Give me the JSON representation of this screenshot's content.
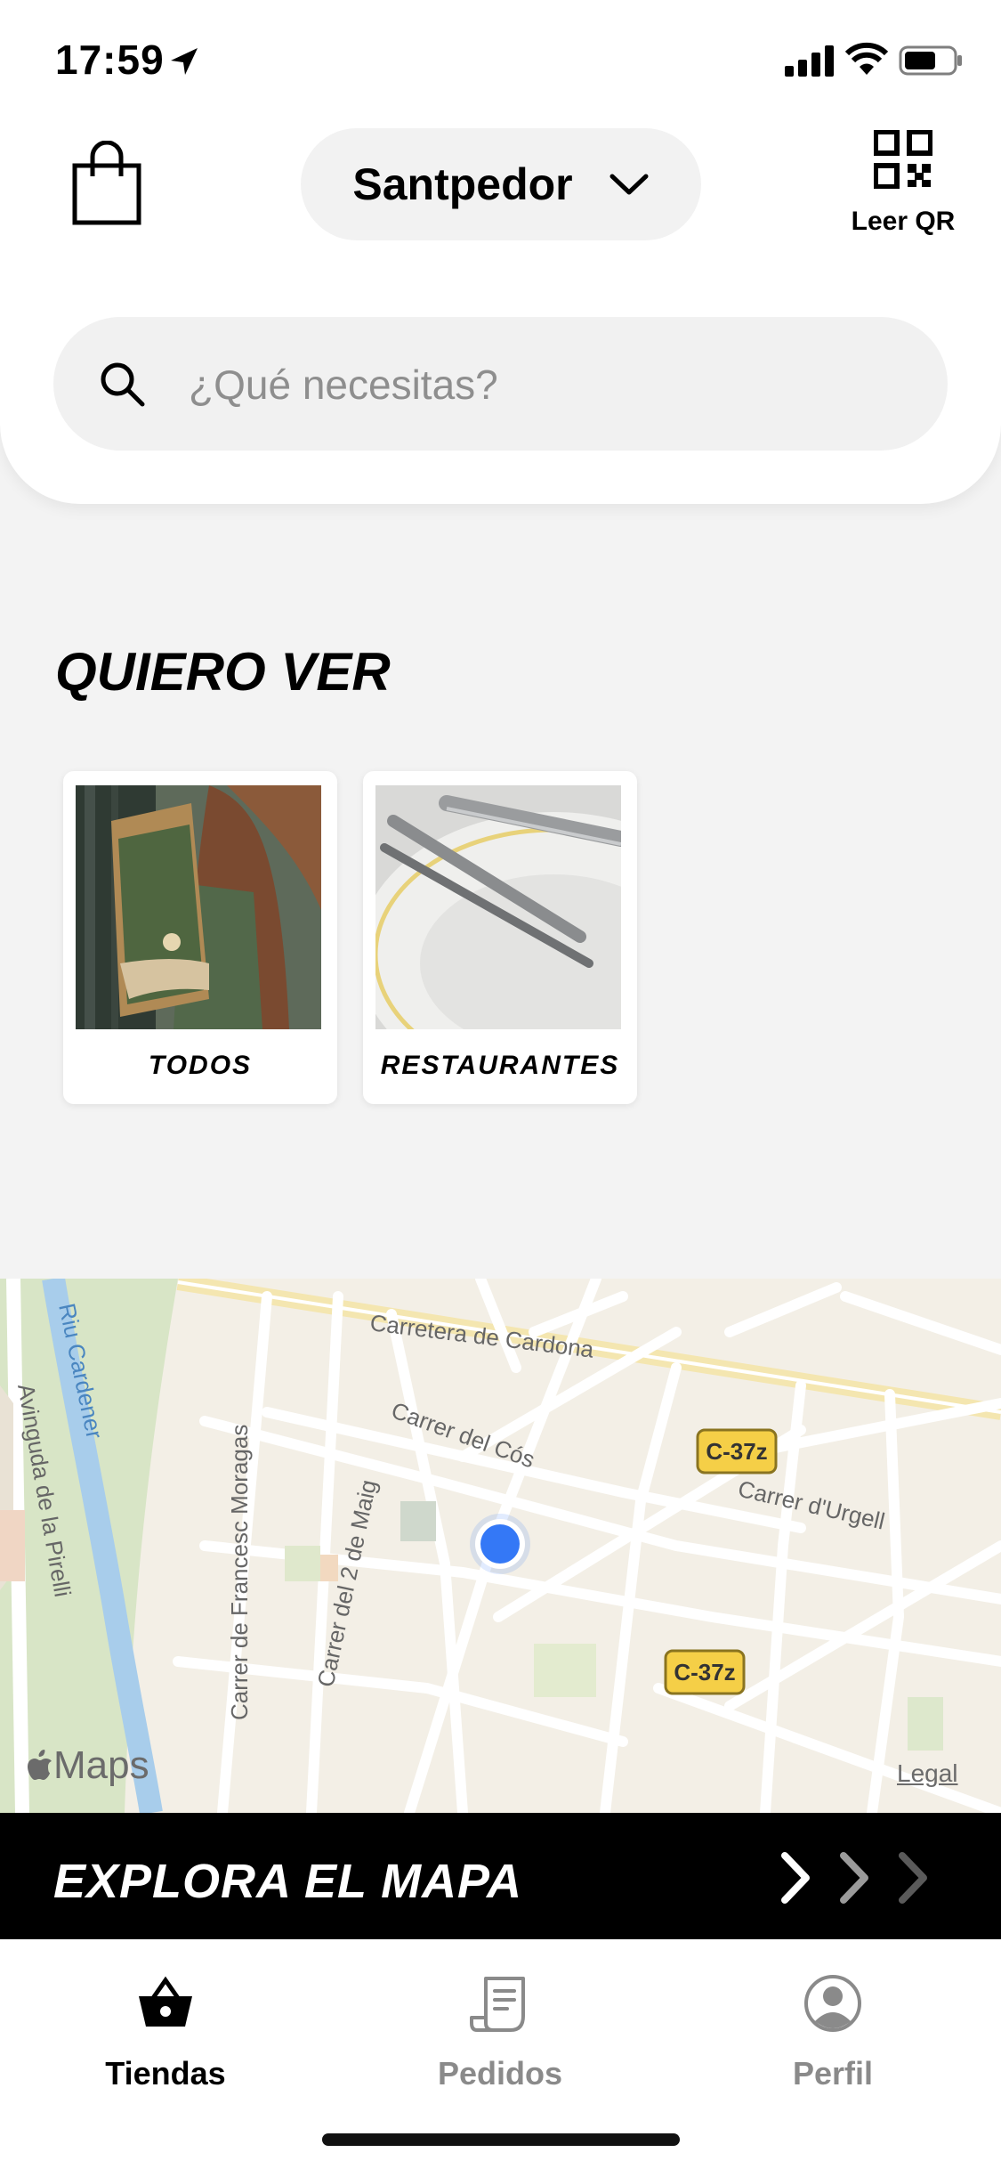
{
  "status_bar": {
    "time": "17:59"
  },
  "header": {
    "location": "Santpedor",
    "qr_label": "Leer QR",
    "search_placeholder": "¿Qué necesitas?"
  },
  "section": {
    "title": "QUIERO VER",
    "categories": [
      {
        "label": "TODOS"
      },
      {
        "label": "RESTAURANTES"
      }
    ]
  },
  "map": {
    "streets": [
      "Carretera de Cardona",
      "Carrer del Cós",
      "Carrer d'Urgell",
      "Carrer de Francesc Moragas",
      "Carrer del 2 de Maig",
      "Avinguda de la Pirelli",
      "Riu Cardener"
    ],
    "road_badge": "C-37z",
    "brand": "Maps",
    "legal": "Legal"
  },
  "explore": {
    "label": "EXPLORA EL MAPA"
  },
  "tabs": [
    {
      "label": "Tiendas",
      "active": true
    },
    {
      "label": "Pedidos",
      "active": false
    },
    {
      "label": "Perfil",
      "active": false
    }
  ],
  "colors": {
    "accent_dark": "#000000",
    "inactive": "#8a8a8a",
    "map_location": "#3478f6",
    "road_badge": "#f5cf47"
  }
}
